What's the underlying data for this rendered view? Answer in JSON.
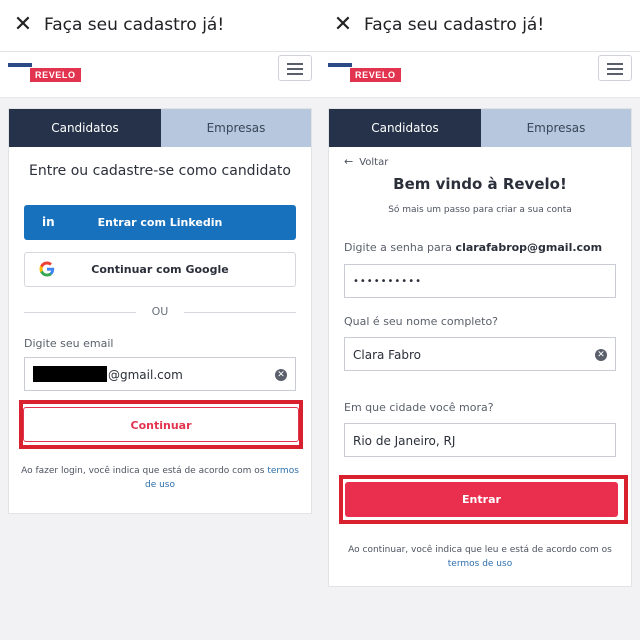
{
  "left": {
    "titlebar": {
      "title": "Faça seu cadastro já!",
      "close_icon": "close-icon"
    },
    "logo_text": "REVELO",
    "tabs": {
      "active": "Candidatos",
      "inactive": "Empresas"
    },
    "heading": "Entre ou cadastre-se como candidato",
    "linkedin": {
      "icon": "in",
      "label": "Entrar com Linkedin"
    },
    "google": {
      "label": "Continuar com Google"
    },
    "divider": "OU",
    "email": {
      "label": "Digite seu email",
      "value_suffix": "@gmail.com"
    },
    "continue_label": "Continuar",
    "terms": {
      "text": "Ao fazer login, você indica que está de acordo com os",
      "link": "termos de uso"
    }
  },
  "right": {
    "titlebar": {
      "title": "Faça seu cadastro já!",
      "close_icon": "close-icon"
    },
    "logo_text": "REVELO",
    "tabs": {
      "active": "Candidatos",
      "inactive": "Empresas"
    },
    "back": "Voltar",
    "heading": "Bem vindo à Revelo!",
    "subheading": "Só mais um passo para criar a sua conta",
    "password": {
      "label_prefix": "Digite a senha para",
      "email": "clarafabrop@gmail.com",
      "value": "••••••••••"
    },
    "name": {
      "label": "Qual é seu nome completo?",
      "value": "Clara Fabro"
    },
    "city": {
      "label": "Em que cidade você mora?",
      "value": "Rio de Janeiro, RJ"
    },
    "enter_label": "Entrar",
    "terms": {
      "text": "Ao continuar, você indica que leu e está de acordo com os",
      "link": "termos de uso"
    }
  },
  "colors": {
    "brand_red": "#e3344f",
    "navy": "#25324a",
    "tab_inactive": "#b7c7dd",
    "linkedin": "#1771bd",
    "highlight": "#d9202f"
  }
}
